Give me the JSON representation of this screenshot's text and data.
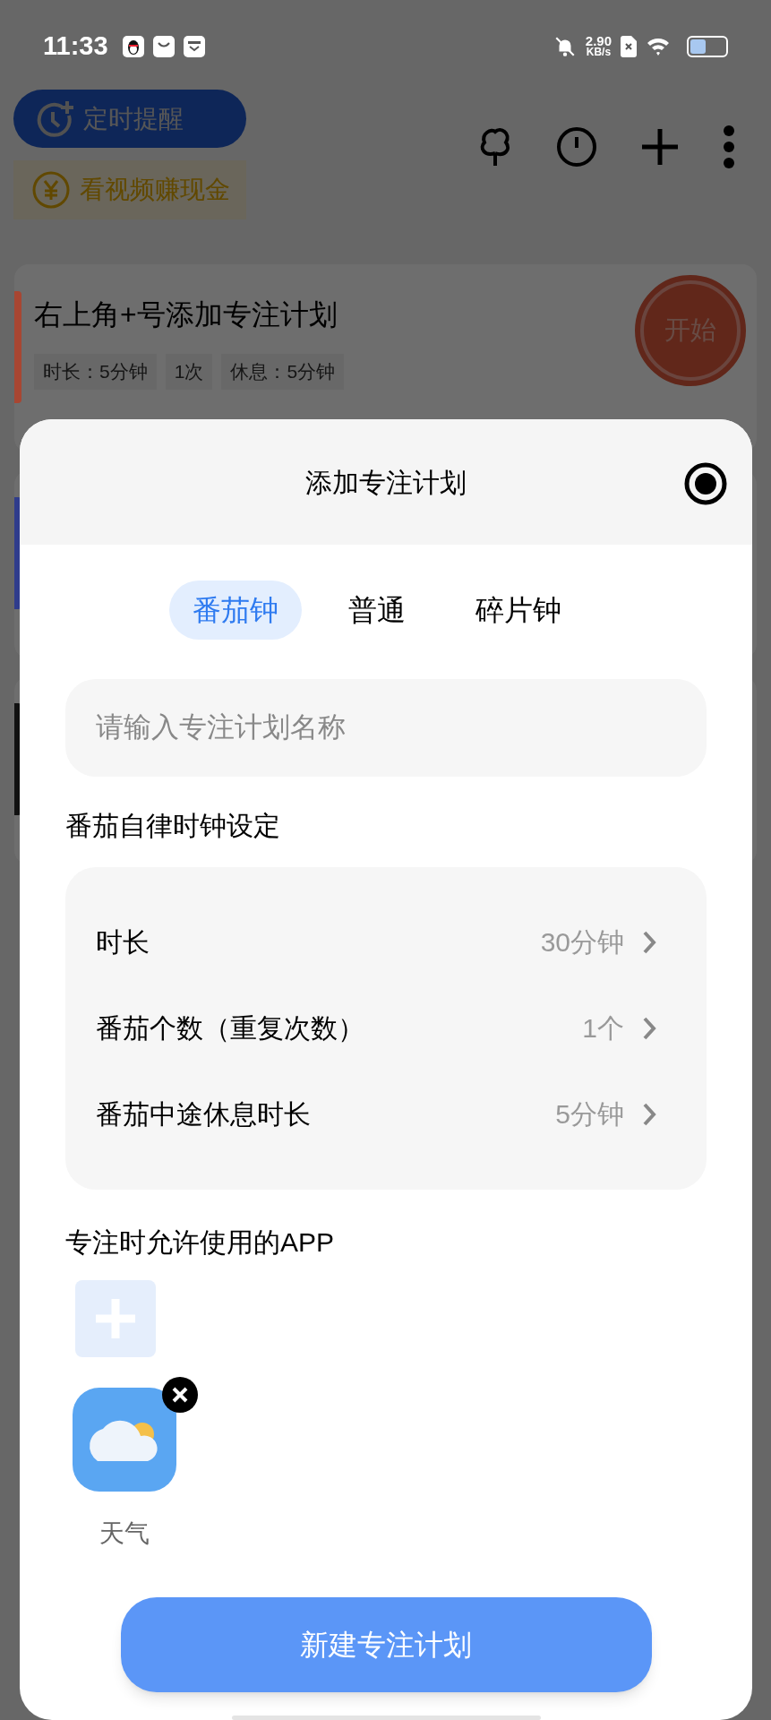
{
  "status_bar": {
    "time": "11:33",
    "net_speed": "2.90",
    "net_unit": "KB/s"
  },
  "header": {
    "reminder_button": "定时提醒",
    "reward_link": "看视频赚现金"
  },
  "plans": [
    {
      "title": "右上角+号添加专注计划",
      "color": "#a84632",
      "tags": [
        "时长：5分钟",
        "1次",
        "休息：5分钟"
      ],
      "start": "开始"
    },
    {
      "color": "#2f3c8c"
    },
    {
      "color": "#111111"
    }
  ],
  "sheet": {
    "title": "添加专注计划",
    "tabs": [
      {
        "label": "番茄钟",
        "selected": true
      },
      {
        "label": "普通",
        "selected": false
      },
      {
        "label": "碎片钟",
        "selected": false
      }
    ],
    "name_field": {
      "placeholder": "请输入专注计划名称"
    },
    "settings_title": "番茄自律时钟设定",
    "settings": [
      {
        "label": "时长",
        "value": "30分钟"
      },
      {
        "label": "番茄个数（重复次数）",
        "value": "1个"
      },
      {
        "label": "番茄中途休息时长",
        "value": "5分钟"
      }
    ],
    "apps_title": "专注时允许使用的APP",
    "apps": [
      {
        "name": "天气"
      }
    ],
    "submit": "新建专注计划"
  }
}
